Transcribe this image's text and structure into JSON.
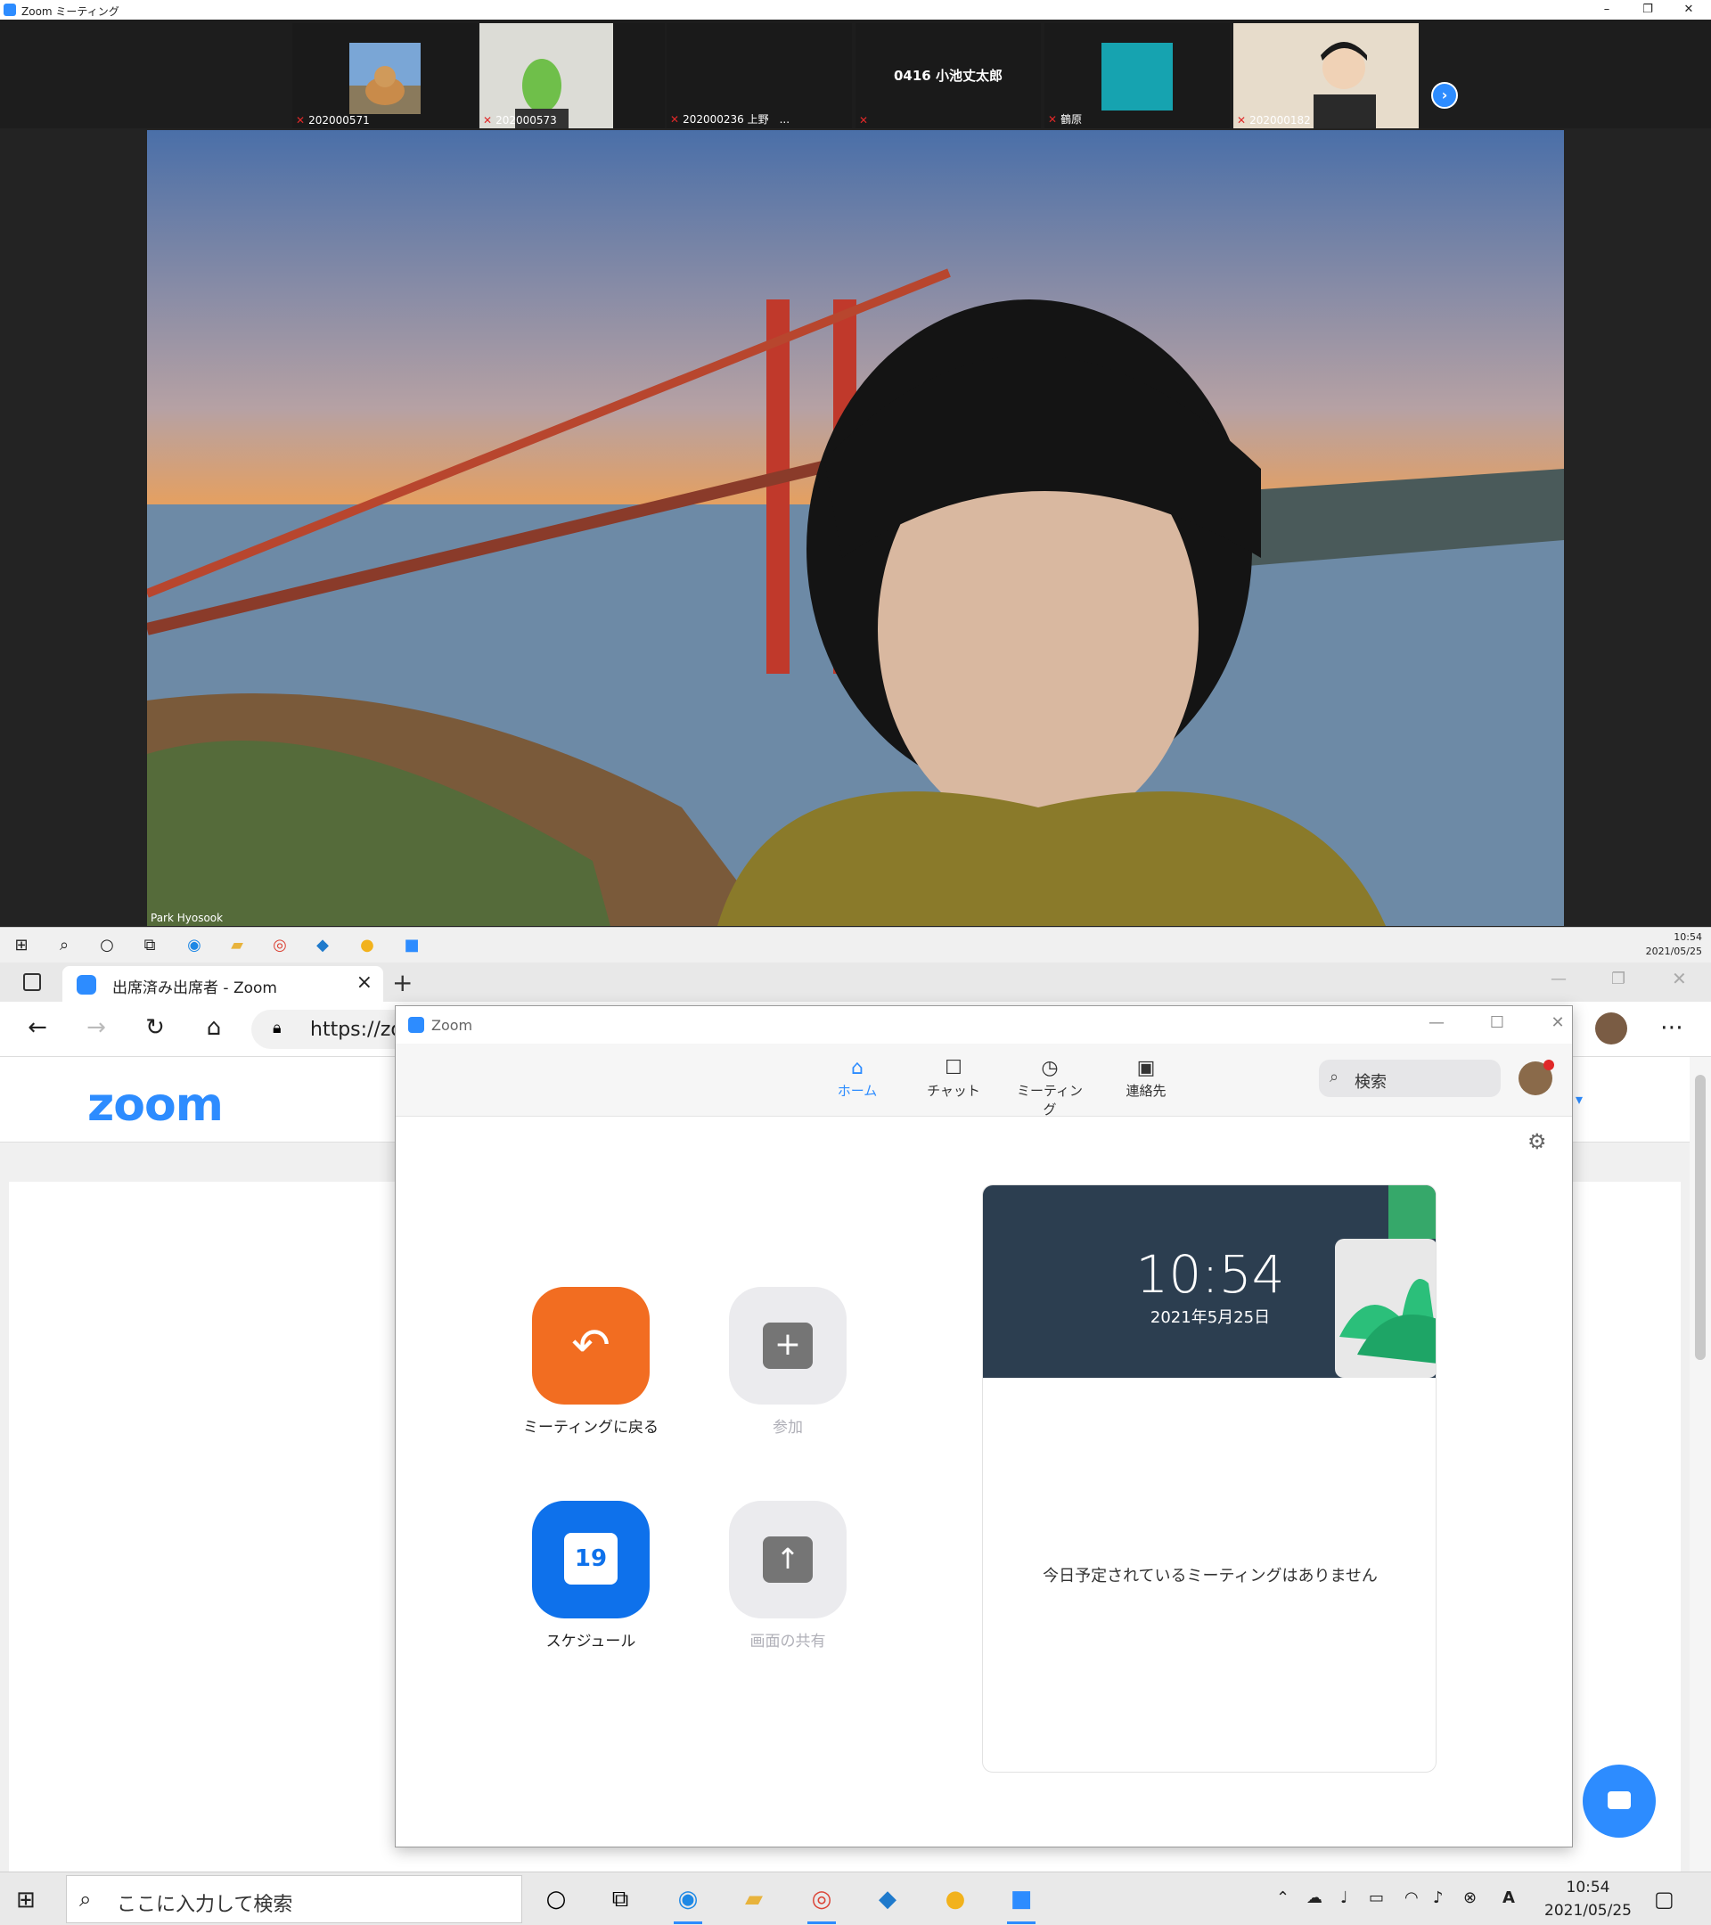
{
  "meeting_window": {
    "title": "Zoom ミーティング",
    "controls": {
      "minimize": "–",
      "restore": "❐",
      "close": "✕"
    },
    "thumbnails": [
      {
        "name": "202000571",
        "muted": true
      },
      {
        "name": "202000573",
        "muted": true
      },
      {
        "name": "202000236 上野　...",
        "muted": true
      },
      {
        "name": "0416 小池丈太郎",
        "muted": true
      },
      {
        "name": "鶴原",
        "muted": true
      },
      {
        "name": "202000182",
        "muted": true
      }
    ],
    "active_speaker": {
      "name": "Park Hyosook"
    }
  },
  "inner_taskbar": {
    "clock_time": "10:54",
    "clock_date": "2021/05/25"
  },
  "browser": {
    "tab_title": "出席済み出席者 - Zoom",
    "url_visible": "https://zo",
    "page": {
      "logo": "zoom"
    }
  },
  "zoom_app": {
    "title": "Zoom",
    "nav": [
      {
        "label": "ホーム",
        "icon": "home-icon",
        "active": true
      },
      {
        "label": "チャット",
        "icon": "chat-icon",
        "active": false
      },
      {
        "label": "ミーティング",
        "icon": "clock-icon",
        "active": false
      },
      {
        "label": "連絡先",
        "icon": "contacts-icon",
        "active": false
      }
    ],
    "search_placeholder": "検索",
    "actions": [
      {
        "label": "ミーティングに戻る",
        "color": "#f26d21",
        "icon": "return-icon",
        "enabled": true
      },
      {
        "label": "参加",
        "color": "#ebebee",
        "icon": "plus-icon",
        "enabled": false
      },
      {
        "label": "スケジュール",
        "color": "#0e71eb",
        "icon": "calendar-icon",
        "calendar_day": "19",
        "enabled": true
      },
      {
        "label": "画面の共有",
        "color": "#ebebee",
        "icon": "share-up-icon",
        "enabled": false
      }
    ],
    "calendar": {
      "time": "10:54",
      "date": "2021年5月25日",
      "empty_message": "今日予定されているミーティングはありません"
    }
  },
  "taskbar": {
    "search_placeholder": "ここに入力して検索",
    "clock_time": "10:54",
    "clock_date": "2021/05/25",
    "ime": "A"
  },
  "colors": {
    "zoom_blue": "#2d8cff",
    "orange": "#f26d21"
  }
}
